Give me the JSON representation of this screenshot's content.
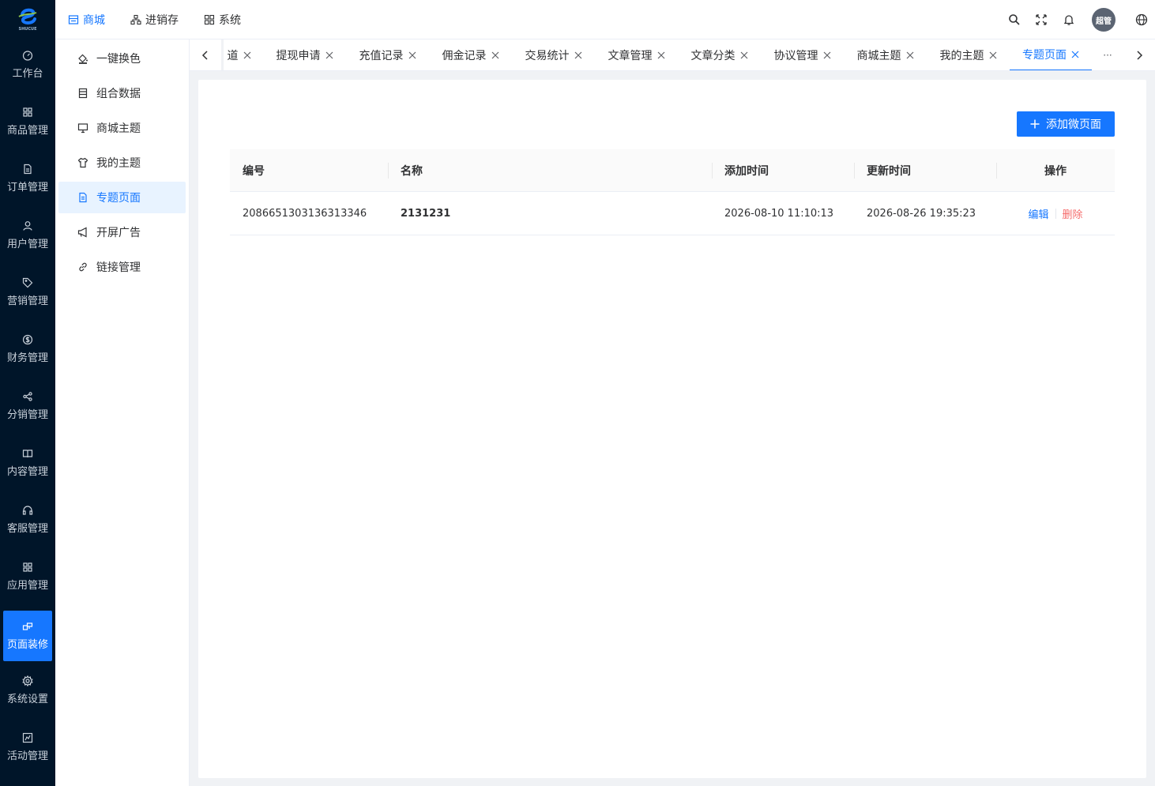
{
  "brand": {
    "logo_text": "SHUCUE",
    "accent": "#1677ff",
    "rail_bg": "#001529"
  },
  "rail": {
    "items": [
      {
        "label": "工作台",
        "icon": "dashboard-icon"
      },
      {
        "label": "商品管理",
        "icon": "grid-icon"
      },
      {
        "label": "订单管理",
        "icon": "document-icon"
      },
      {
        "label": "用户管理",
        "icon": "user-icon"
      },
      {
        "label": "营销管理",
        "icon": "tag-icon"
      },
      {
        "label": "财务管理",
        "icon": "dollar-icon"
      },
      {
        "label": "分销管理",
        "icon": "share-icon"
      },
      {
        "label": "内容管理",
        "icon": "book-icon"
      },
      {
        "label": "客服管理",
        "icon": "headset-icon"
      },
      {
        "label": "应用管理",
        "icon": "apps-icon"
      },
      {
        "label": "页面装修",
        "icon": "decorate-icon",
        "active": true
      },
      {
        "label": "系统设置",
        "icon": "gear-icon"
      },
      {
        "label": "活动管理",
        "icon": "activity-icon"
      }
    ]
  },
  "topnav": {
    "items": [
      {
        "label": "商城",
        "icon": "store-icon",
        "active": true
      },
      {
        "label": "进销存",
        "icon": "hierarchy-icon"
      },
      {
        "label": "系统",
        "icon": "system-icon"
      }
    ],
    "avatar_text": "超管"
  },
  "submenu": {
    "items": [
      {
        "label": "一键换色",
        "icon": "paint-bucket-icon"
      },
      {
        "label": "组合数据",
        "icon": "database-icon"
      },
      {
        "label": "商城主题",
        "icon": "monitor-icon"
      },
      {
        "label": "我的主题",
        "icon": "shirt-icon"
      },
      {
        "label": "专题页面",
        "icon": "page-icon",
        "active": true
      },
      {
        "label": "开屏广告",
        "icon": "megaphone-icon"
      },
      {
        "label": "链接管理",
        "icon": "link-icon"
      }
    ]
  },
  "tabs": {
    "items": [
      {
        "label": "道",
        "partial": true
      },
      {
        "label": "提现申请"
      },
      {
        "label": "充值记录"
      },
      {
        "label": "佣金记录"
      },
      {
        "label": "交易统计"
      },
      {
        "label": "文章管理"
      },
      {
        "label": "文章分类"
      },
      {
        "label": "协议管理"
      },
      {
        "label": "商城主题"
      },
      {
        "label": "我的主题"
      },
      {
        "label": "专题页面",
        "active": true
      }
    ],
    "more": "···"
  },
  "content": {
    "add_button": "添加微页面",
    "columns": [
      "编号",
      "名称",
      "添加时间",
      "更新时间",
      "操作"
    ],
    "rows": [
      {
        "id": "2086651303136313346",
        "name": "2131231",
        "created": "2026-08-10 11:10:13",
        "updated": "2026-08-26 19:35:23",
        "edit": "编辑",
        "delete": "删除"
      }
    ]
  }
}
